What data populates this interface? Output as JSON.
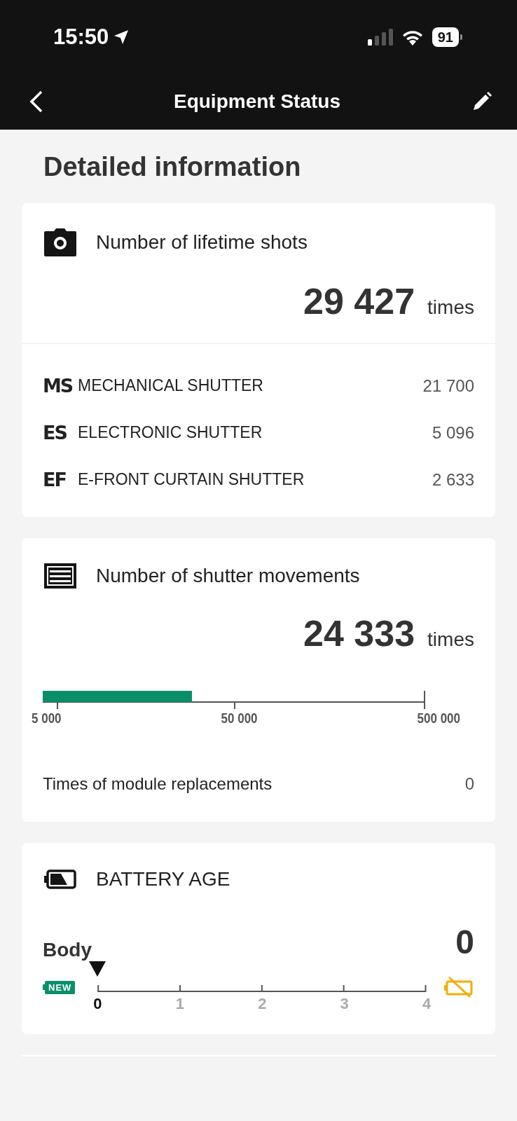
{
  "status_bar": {
    "time": "15:50",
    "battery": "91"
  },
  "nav": {
    "title": "Equipment Status"
  },
  "heading": "Detailed information",
  "lifetime_shots": {
    "title": "Number of lifetime shots",
    "value": "29 427",
    "unit": "times",
    "breakdown": [
      {
        "abbr": "MS",
        "label": "MECHANICAL SHUTTER",
        "count": "21 700"
      },
      {
        "abbr": "ES",
        "label": "ELECTRONIC SHUTTER",
        "count": "5 096"
      },
      {
        "abbr": "EF",
        "label": "E-FRONT CURTAIN SHUTTER",
        "count": "2 633"
      }
    ]
  },
  "shutter_movements": {
    "title": "Number of shutter movements",
    "value": "24 333",
    "unit": "times",
    "level": 0.39,
    "scale_labels": [
      "5 000",
      "50 000",
      "500 000"
    ],
    "module_replacements": {
      "label": "Times of module replacements",
      "value": "0"
    }
  },
  "battery_age": {
    "title": "BATTERY AGE",
    "body_label": "Body",
    "value": "0",
    "new_badge": "NEW",
    "ticks": [
      {
        "label": "0",
        "selected": true
      },
      {
        "label": "1",
        "selected": false
      },
      {
        "label": "2",
        "selected": false
      },
      {
        "label": "3",
        "selected": false
      },
      {
        "label": "4",
        "selected": false
      }
    ]
  }
}
